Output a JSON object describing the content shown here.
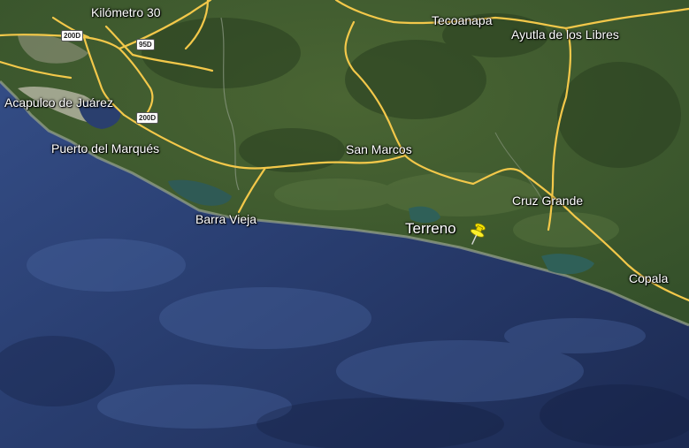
{
  "places": {
    "kilometro30": "Kilómetro 30",
    "tecoanapa": "Tecoanapa",
    "ayutla": "Ayutla de los Libres",
    "acapulco": "Acapulco de Juárez",
    "puerto_marques": "Puerto del Marqués",
    "san_marcos": "San Marcos",
    "cruz_grande": "Cruz Grande",
    "barra_vieja": "Barra Vieja",
    "terreno": "Terreno",
    "copala": "Copala"
  },
  "shields": {
    "hwy_200_a": "200D",
    "hwy_95": "95D",
    "hwy_200_b": "200D"
  },
  "colors": {
    "land": "#3f5a2c",
    "land_dark": "#2c4322",
    "sea": "#22335e",
    "sea_light": "#3c5a95",
    "road": "#f3c84a",
    "lagoon": "#2d5a52",
    "city": "#b8b9a8",
    "pin": "#f6e600"
  },
  "icons": {
    "marker": "yellow-pushpin-icon"
  }
}
